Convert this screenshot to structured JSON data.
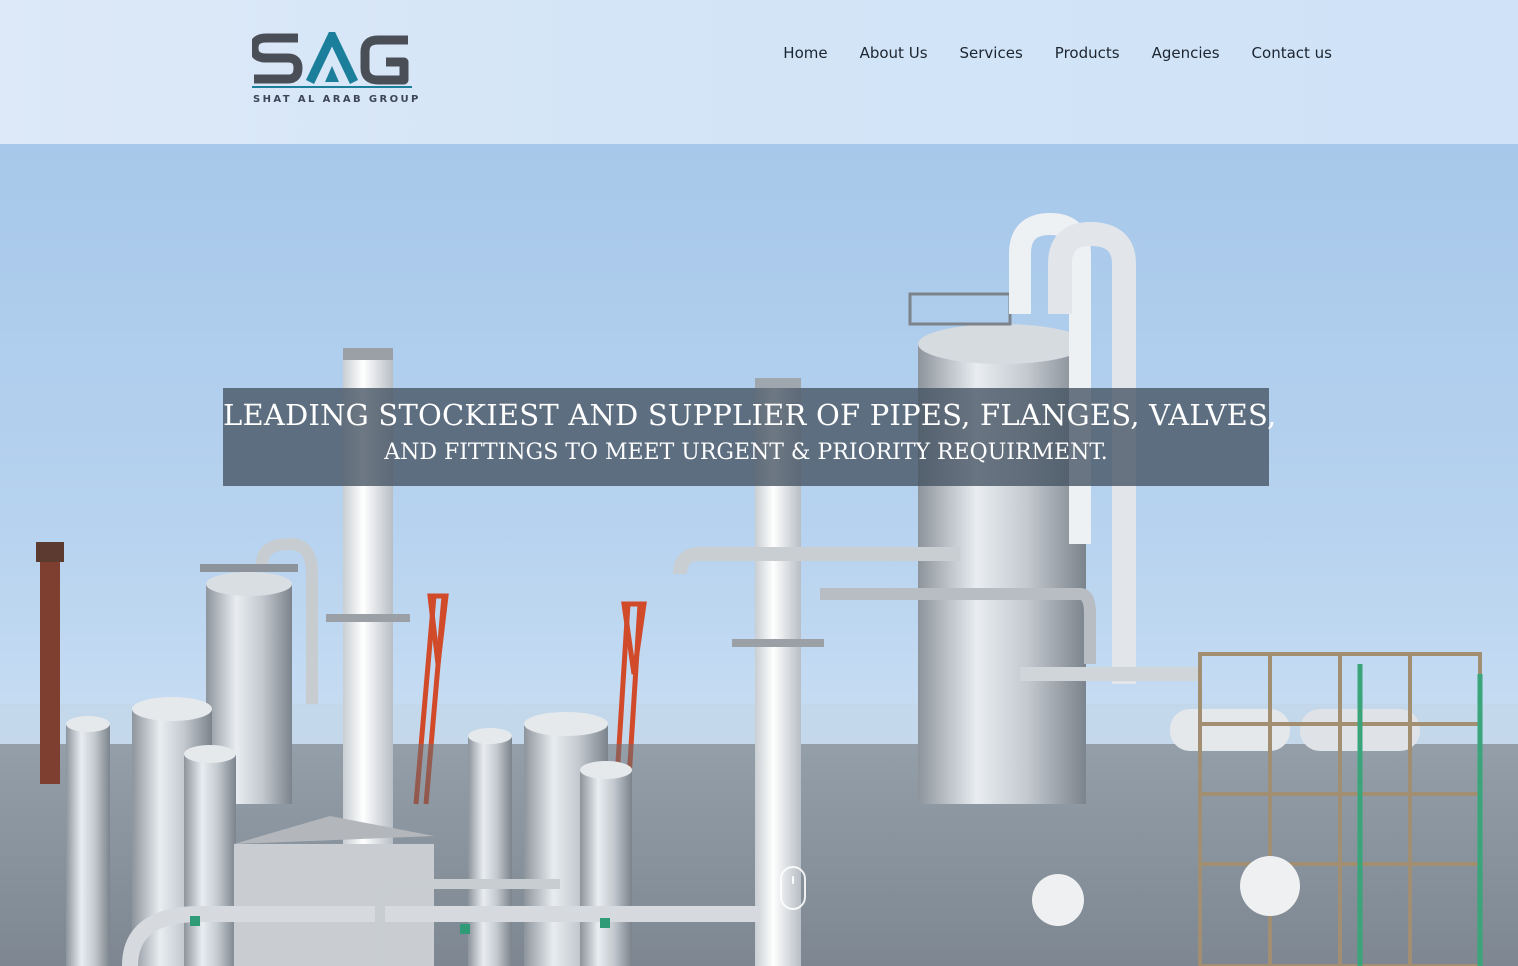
{
  "brand": {
    "logo_text": "SAG",
    "tagline": "SHAT AL ARAB GROUP"
  },
  "nav": {
    "items": [
      {
        "label": "Home"
      },
      {
        "label": "About Us"
      },
      {
        "label": "Services"
      },
      {
        "label": "Products"
      },
      {
        "label": "Agencies"
      },
      {
        "label": "Contact us"
      }
    ]
  },
  "hero": {
    "headline_line1": "LEADING STOCKIEST AND SUPPLIER OF PIPES, FLANGES, VALVES,",
    "headline_line2": "AND FITTINGS TO MEET URGENT & PRIORITY REQUIRMENT.",
    "image_icon": "refinery-photo",
    "scroll_icon": "scroll-down-mouse-icon"
  },
  "colors": {
    "logo_dark": "#4a4f57",
    "logo_accent": "#1b7f9c",
    "banner_overlay": "#445262",
    "nav_text": "#1d2530"
  }
}
